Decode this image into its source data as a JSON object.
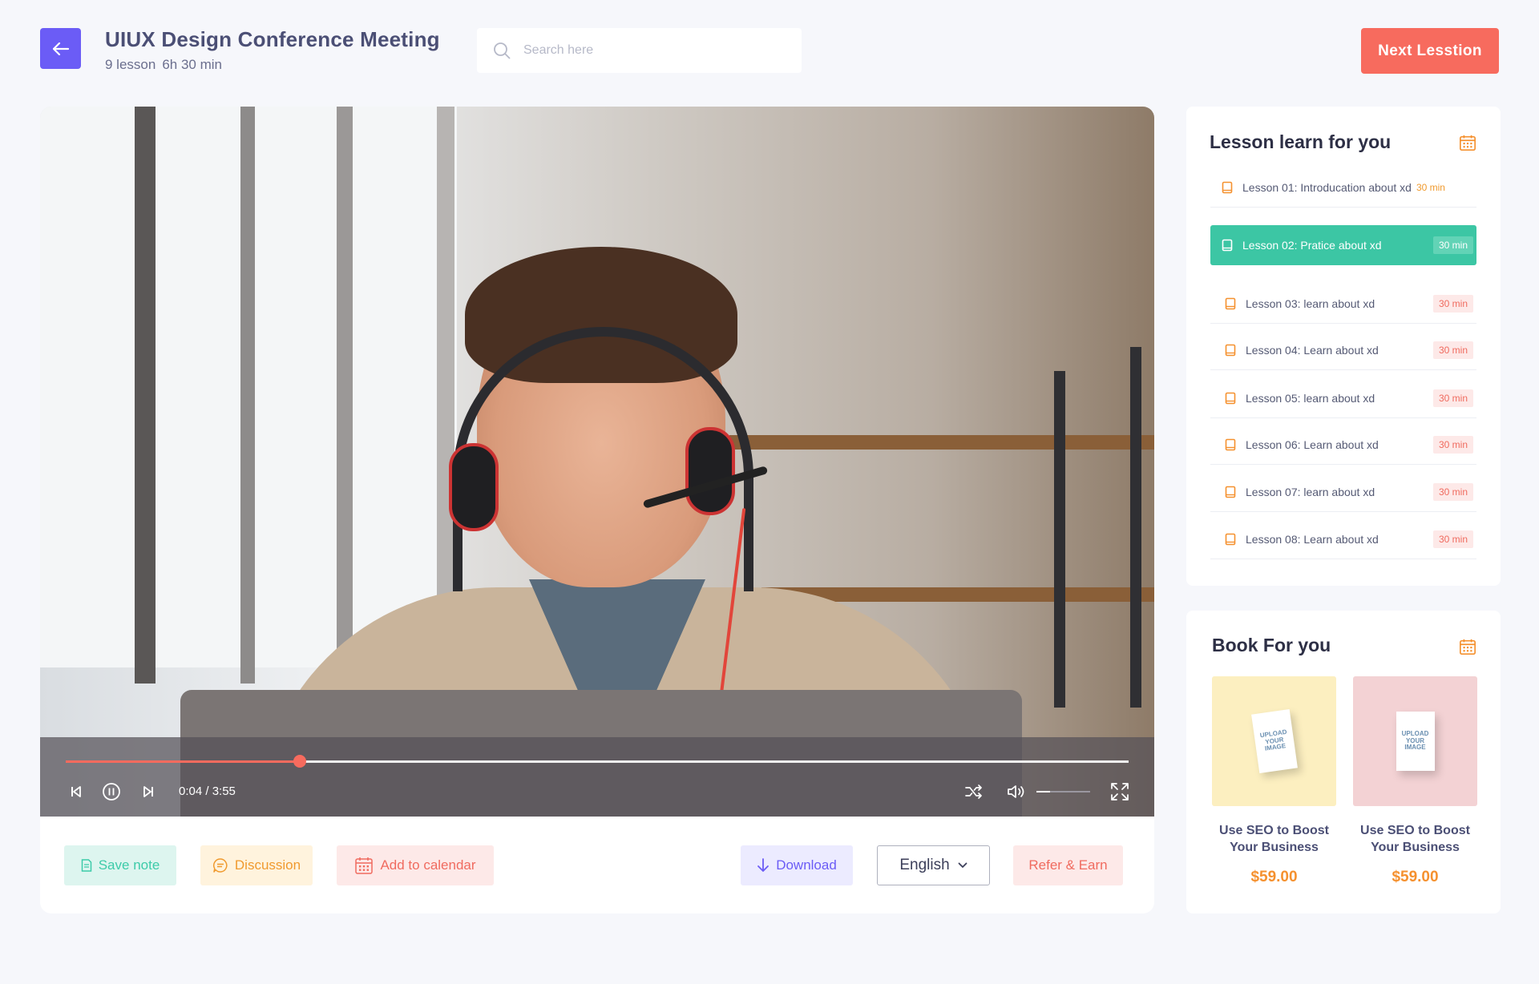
{
  "header": {
    "title": "UIUX Design Conference Meeting",
    "lessons": "9 lesson",
    "duration": "6h 30 min",
    "search_placeholder": "Search here",
    "next_label": "Next Lesstion"
  },
  "player": {
    "time": "0:04 / 3:55",
    "progress": 0.22,
    "volume": 0.25
  },
  "actions": {
    "save_note": "Save note",
    "discussion": "Discussion",
    "add_calendar": "Add to calendar",
    "download": "Download",
    "language": "English",
    "refer": "Refer & Earn"
  },
  "lessons": {
    "title": "Lesson learn for you",
    "items": [
      {
        "label": "Lesson 01: Introducation about xd",
        "duration": "30 min"
      },
      {
        "label": "Lesson 02: Pratice about xd",
        "duration": "30 min"
      },
      {
        "label": "Lesson 03: learn about xd",
        "duration": "30 min"
      },
      {
        "label": "Lesson 04: Learn about xd",
        "duration": "30 min"
      },
      {
        "label": "Lesson 05: learn about xd",
        "duration": "30 min"
      },
      {
        "label": "Lesson 06: Learn about xd",
        "duration": "30 min"
      },
      {
        "label": "Lesson 07: learn about xd",
        "duration": "30 min"
      },
      {
        "label": "Lesson 08: Learn about xd",
        "duration": "30 min"
      }
    ]
  },
  "books": {
    "title": "Book For you",
    "items": [
      {
        "title_line1": "Use SEO to Boost",
        "title_line2": "Your Business",
        "price": "$59.00",
        "cover_text": "UPLOAD YOUR IMAGE",
        "cover_color": "#fcefc0"
      },
      {
        "title_line1": "Use SEO to Boost",
        "title_line2": "Your Business",
        "price": "$59.00",
        "cover_text": "UPLOAD YOUR IMAGE",
        "cover_color": "#f3d2d4"
      }
    ]
  },
  "colors": {
    "accent": "#6b5cf6",
    "primary_action": "#f76b5e",
    "active_lesson": "#3cc6a4",
    "price": "#f5912f"
  }
}
